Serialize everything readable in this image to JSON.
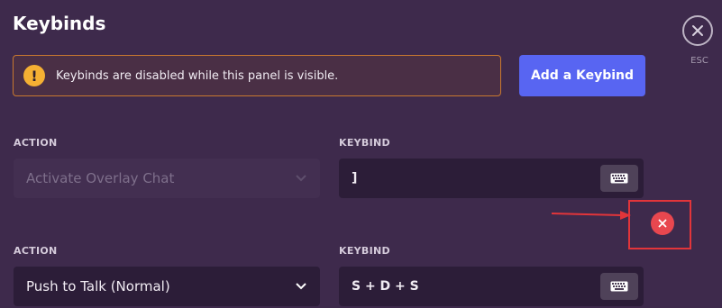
{
  "header": {
    "title": "Keybinds",
    "close_label": "ESC"
  },
  "warning": {
    "icon": "exclamation-icon",
    "text": "Keybinds are disabled while this panel is visible."
  },
  "add_button": {
    "label": "Add a Keybind"
  },
  "colors": {
    "background": "#3e2a4c",
    "accent": "#5865f2",
    "warning": "#f5b033",
    "danger": "#e8474f",
    "highlight": "#e2353a"
  },
  "rows": [
    {
      "action_header": "ACTION",
      "keybind_header": "KEYBIND",
      "action": "Activate Overlay Chat",
      "action_disabled": true,
      "keybind": "]"
    },
    {
      "action_header": "ACTION",
      "keybind_header": "KEYBIND",
      "action": "Push to Talk (Normal)",
      "action_disabled": false,
      "keybind": "S + D + S"
    }
  ]
}
